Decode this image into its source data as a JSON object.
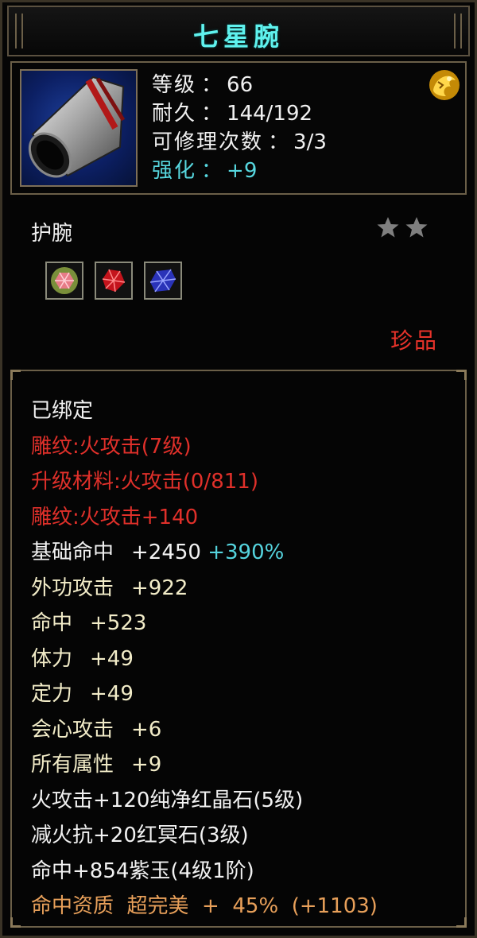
{
  "item": {
    "name": "七星腕",
    "type": "护腕",
    "rarity": "珍品",
    "star_count": 2
  },
  "core_stats": {
    "level_label": "等级",
    "level_value": "66",
    "durability_label": "耐久",
    "durability_value": "144/192",
    "repair_label": "可修理次数",
    "repair_value": "3/3",
    "enhance_label": "强化",
    "enhance_value": "+9",
    "separator": "："
  },
  "icons": {
    "item_icon": "bracer-icon",
    "badge": "gold-dragon-badge-icon",
    "star": "star-icon",
    "gems": [
      "pink-gem-icon",
      "red-gem-icon",
      "blue-gem-icon"
    ]
  },
  "attributes": [
    {
      "text": "已绑定",
      "color": "white"
    },
    {
      "text": "雕纹:火攻击(7级)",
      "color": "red"
    },
    {
      "text": "升级材料:火攻击(0/811)",
      "color": "red"
    },
    {
      "text": "雕纹:火攻击+140",
      "color": "red"
    },
    {
      "name": "基础命中",
      "value": "+2450",
      "extra": "+390%",
      "color": "white"
    },
    {
      "name": "外功攻击",
      "value": "+922",
      "color": "yellow"
    },
    {
      "name": "命中",
      "value": "+523",
      "color": "yellow"
    },
    {
      "name": "体力",
      "value": "+49",
      "color": "yellow"
    },
    {
      "name": "定力",
      "value": "+49",
      "color": "yellow"
    },
    {
      "name": "会心攻击",
      "value": "+6",
      "color": "yellow"
    },
    {
      "name": "所有属性",
      "value": "+9",
      "color": "yellow"
    },
    {
      "text": "火攻击+120纯净红晶石(5级)",
      "color": "white"
    },
    {
      "text": "减火抗+20红冥石(3级)",
      "color": "white"
    },
    {
      "text": "命中+854紫玉(4级1阶)",
      "color": "white"
    },
    {
      "text": "命中资质  超完美  +  45%  (+1103)",
      "color": "orange"
    }
  ],
  "colors": {
    "title": "#5ff2ee",
    "white": "#f2f2f2",
    "red": "#e0302a",
    "yellow": "#f2ecc8",
    "blue": "#55d4de",
    "orange": "#e8a05a",
    "border": "#6b5f48"
  }
}
